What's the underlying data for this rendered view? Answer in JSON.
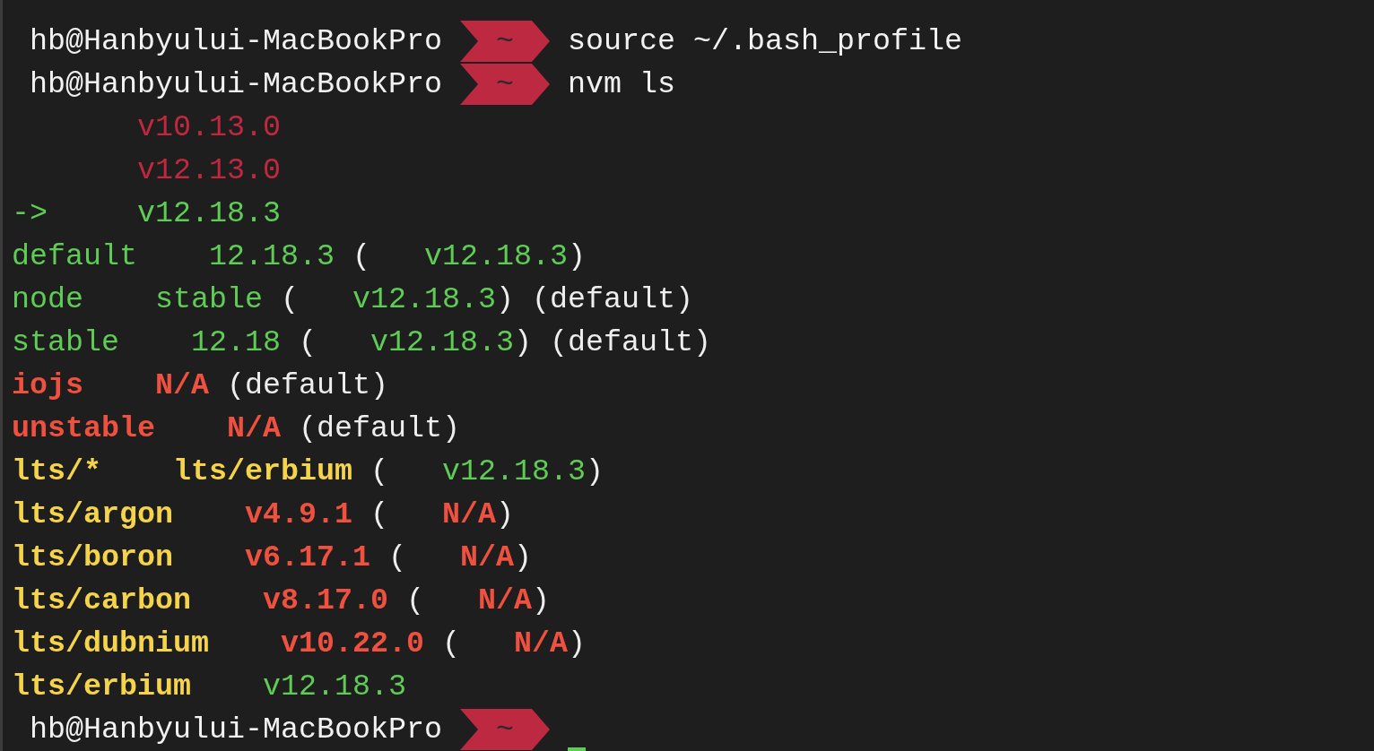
{
  "lines": [
    {
      "kind": "prompt",
      "host": "hb@Hanbyului-MacBookPro",
      "dir": "~",
      "command": "source ~/.bash_profile",
      "cursor": false
    },
    {
      "kind": "prompt",
      "host": "hb@Hanbyului-MacBookPro",
      "dir": "~",
      "command": "nvm ls",
      "cursor": false
    },
    {
      "kind": "output",
      "segments": [
        {
          "text": "       v10.13.0",
          "color": "#c0283f",
          "bold": false
        }
      ]
    },
    {
      "kind": "output",
      "segments": [
        {
          "text": "       v12.13.0",
          "color": "#c0283f",
          "bold": false
        }
      ]
    },
    {
      "kind": "output",
      "segments": [
        {
          "text": "->     ",
          "color": "#5fcd55",
          "bold": false
        },
        {
          "text": "v12.18.3",
          "color": "#5fcd55",
          "bold": false
        }
      ]
    },
    {
      "kind": "output",
      "segments": [
        {
          "text": "default    ",
          "color": "#5fcd55",
          "bold": false
        },
        {
          "text": "12.18.3",
          "color": "#5fcd55",
          "bold": false
        },
        {
          "text": " (   ",
          "color": "#eeeeee",
          "bold": false
        },
        {
          "text": "v12.18.3",
          "color": "#5fcd55",
          "bold": false
        },
        {
          "text": ")",
          "color": "#eeeeee",
          "bold": false
        }
      ]
    },
    {
      "kind": "output",
      "segments": [
        {
          "text": "node    ",
          "color": "#5fcd55",
          "bold": false
        },
        {
          "text": "stable",
          "color": "#5fcd55",
          "bold": false
        },
        {
          "text": " (   ",
          "color": "#eeeeee",
          "bold": false
        },
        {
          "text": "v12.18.3",
          "color": "#5fcd55",
          "bold": false
        },
        {
          "text": ") (default)",
          "color": "#eeeeee",
          "bold": false
        }
      ]
    },
    {
      "kind": "output",
      "segments": [
        {
          "text": "stable    ",
          "color": "#5fcd55",
          "bold": false
        },
        {
          "text": "12.18",
          "color": "#5fcd55",
          "bold": false
        },
        {
          "text": " (   ",
          "color": "#eeeeee",
          "bold": false
        },
        {
          "text": "v12.18.3",
          "color": "#5fcd55",
          "bold": false
        },
        {
          "text": ") (default)",
          "color": "#eeeeee",
          "bold": false
        }
      ]
    },
    {
      "kind": "output",
      "segments": [
        {
          "text": "iojs    ",
          "color": "#f0513f",
          "bold": true
        },
        {
          "text": "N/A",
          "color": "#f0513f",
          "bold": true
        },
        {
          "text": " (default)",
          "color": "#eeeeee",
          "bold": false
        }
      ]
    },
    {
      "kind": "output",
      "segments": [
        {
          "text": "unstable    ",
          "color": "#f0513f",
          "bold": true
        },
        {
          "text": "N/A",
          "color": "#f0513f",
          "bold": true
        },
        {
          "text": " (default)",
          "color": "#eeeeee",
          "bold": false
        }
      ]
    },
    {
      "kind": "output",
      "segments": [
        {
          "text": "lts/*    ",
          "color": "#f5d44a",
          "bold": true
        },
        {
          "text": "lts/erbium",
          "color": "#f5d44a",
          "bold": true
        },
        {
          "text": " (   ",
          "color": "#eeeeee",
          "bold": false
        },
        {
          "text": "v12.18.3",
          "color": "#5fcd55",
          "bold": false
        },
        {
          "text": ")",
          "color": "#eeeeee",
          "bold": false
        }
      ]
    },
    {
      "kind": "output",
      "segments": [
        {
          "text": "lts/argon    ",
          "color": "#f5d44a",
          "bold": true
        },
        {
          "text": "v4.9.1",
          "color": "#f0513f",
          "bold": true
        },
        {
          "text": " (   ",
          "color": "#eeeeee",
          "bold": false
        },
        {
          "text": "N/A",
          "color": "#f0513f",
          "bold": true
        },
        {
          "text": ")",
          "color": "#eeeeee",
          "bold": false
        }
      ]
    },
    {
      "kind": "output",
      "segments": [
        {
          "text": "lts/boron    ",
          "color": "#f5d44a",
          "bold": true
        },
        {
          "text": "v6.17.1",
          "color": "#f0513f",
          "bold": true
        },
        {
          "text": " (   ",
          "color": "#eeeeee",
          "bold": false
        },
        {
          "text": "N/A",
          "color": "#f0513f",
          "bold": true
        },
        {
          "text": ")",
          "color": "#eeeeee",
          "bold": false
        }
      ]
    },
    {
      "kind": "output",
      "segments": [
        {
          "text": "lts/carbon    ",
          "color": "#f5d44a",
          "bold": true
        },
        {
          "text": "v8.17.0",
          "color": "#f0513f",
          "bold": true
        },
        {
          "text": " (   ",
          "color": "#eeeeee",
          "bold": false
        },
        {
          "text": "N/A",
          "color": "#f0513f",
          "bold": true
        },
        {
          "text": ")",
          "color": "#eeeeee",
          "bold": false
        }
      ]
    },
    {
      "kind": "output",
      "segments": [
        {
          "text": "lts/dubnium    ",
          "color": "#f5d44a",
          "bold": true
        },
        {
          "text": "v10.22.0",
          "color": "#f0513f",
          "bold": true
        },
        {
          "text": " (   ",
          "color": "#eeeeee",
          "bold": false
        },
        {
          "text": "N/A",
          "color": "#f0513f",
          "bold": true
        },
        {
          "text": ")",
          "color": "#eeeeee",
          "bold": false
        }
      ]
    },
    {
      "kind": "output",
      "segments": [
        {
          "text": "lts/erbium    ",
          "color": "#f5d44a",
          "bold": true
        },
        {
          "text": "v12.18.3",
          "color": "#5fcd55",
          "bold": false
        }
      ]
    },
    {
      "kind": "prompt",
      "host": "hb@Hanbyului-MacBookPro",
      "dir": "~",
      "cursor": true
    }
  ]
}
